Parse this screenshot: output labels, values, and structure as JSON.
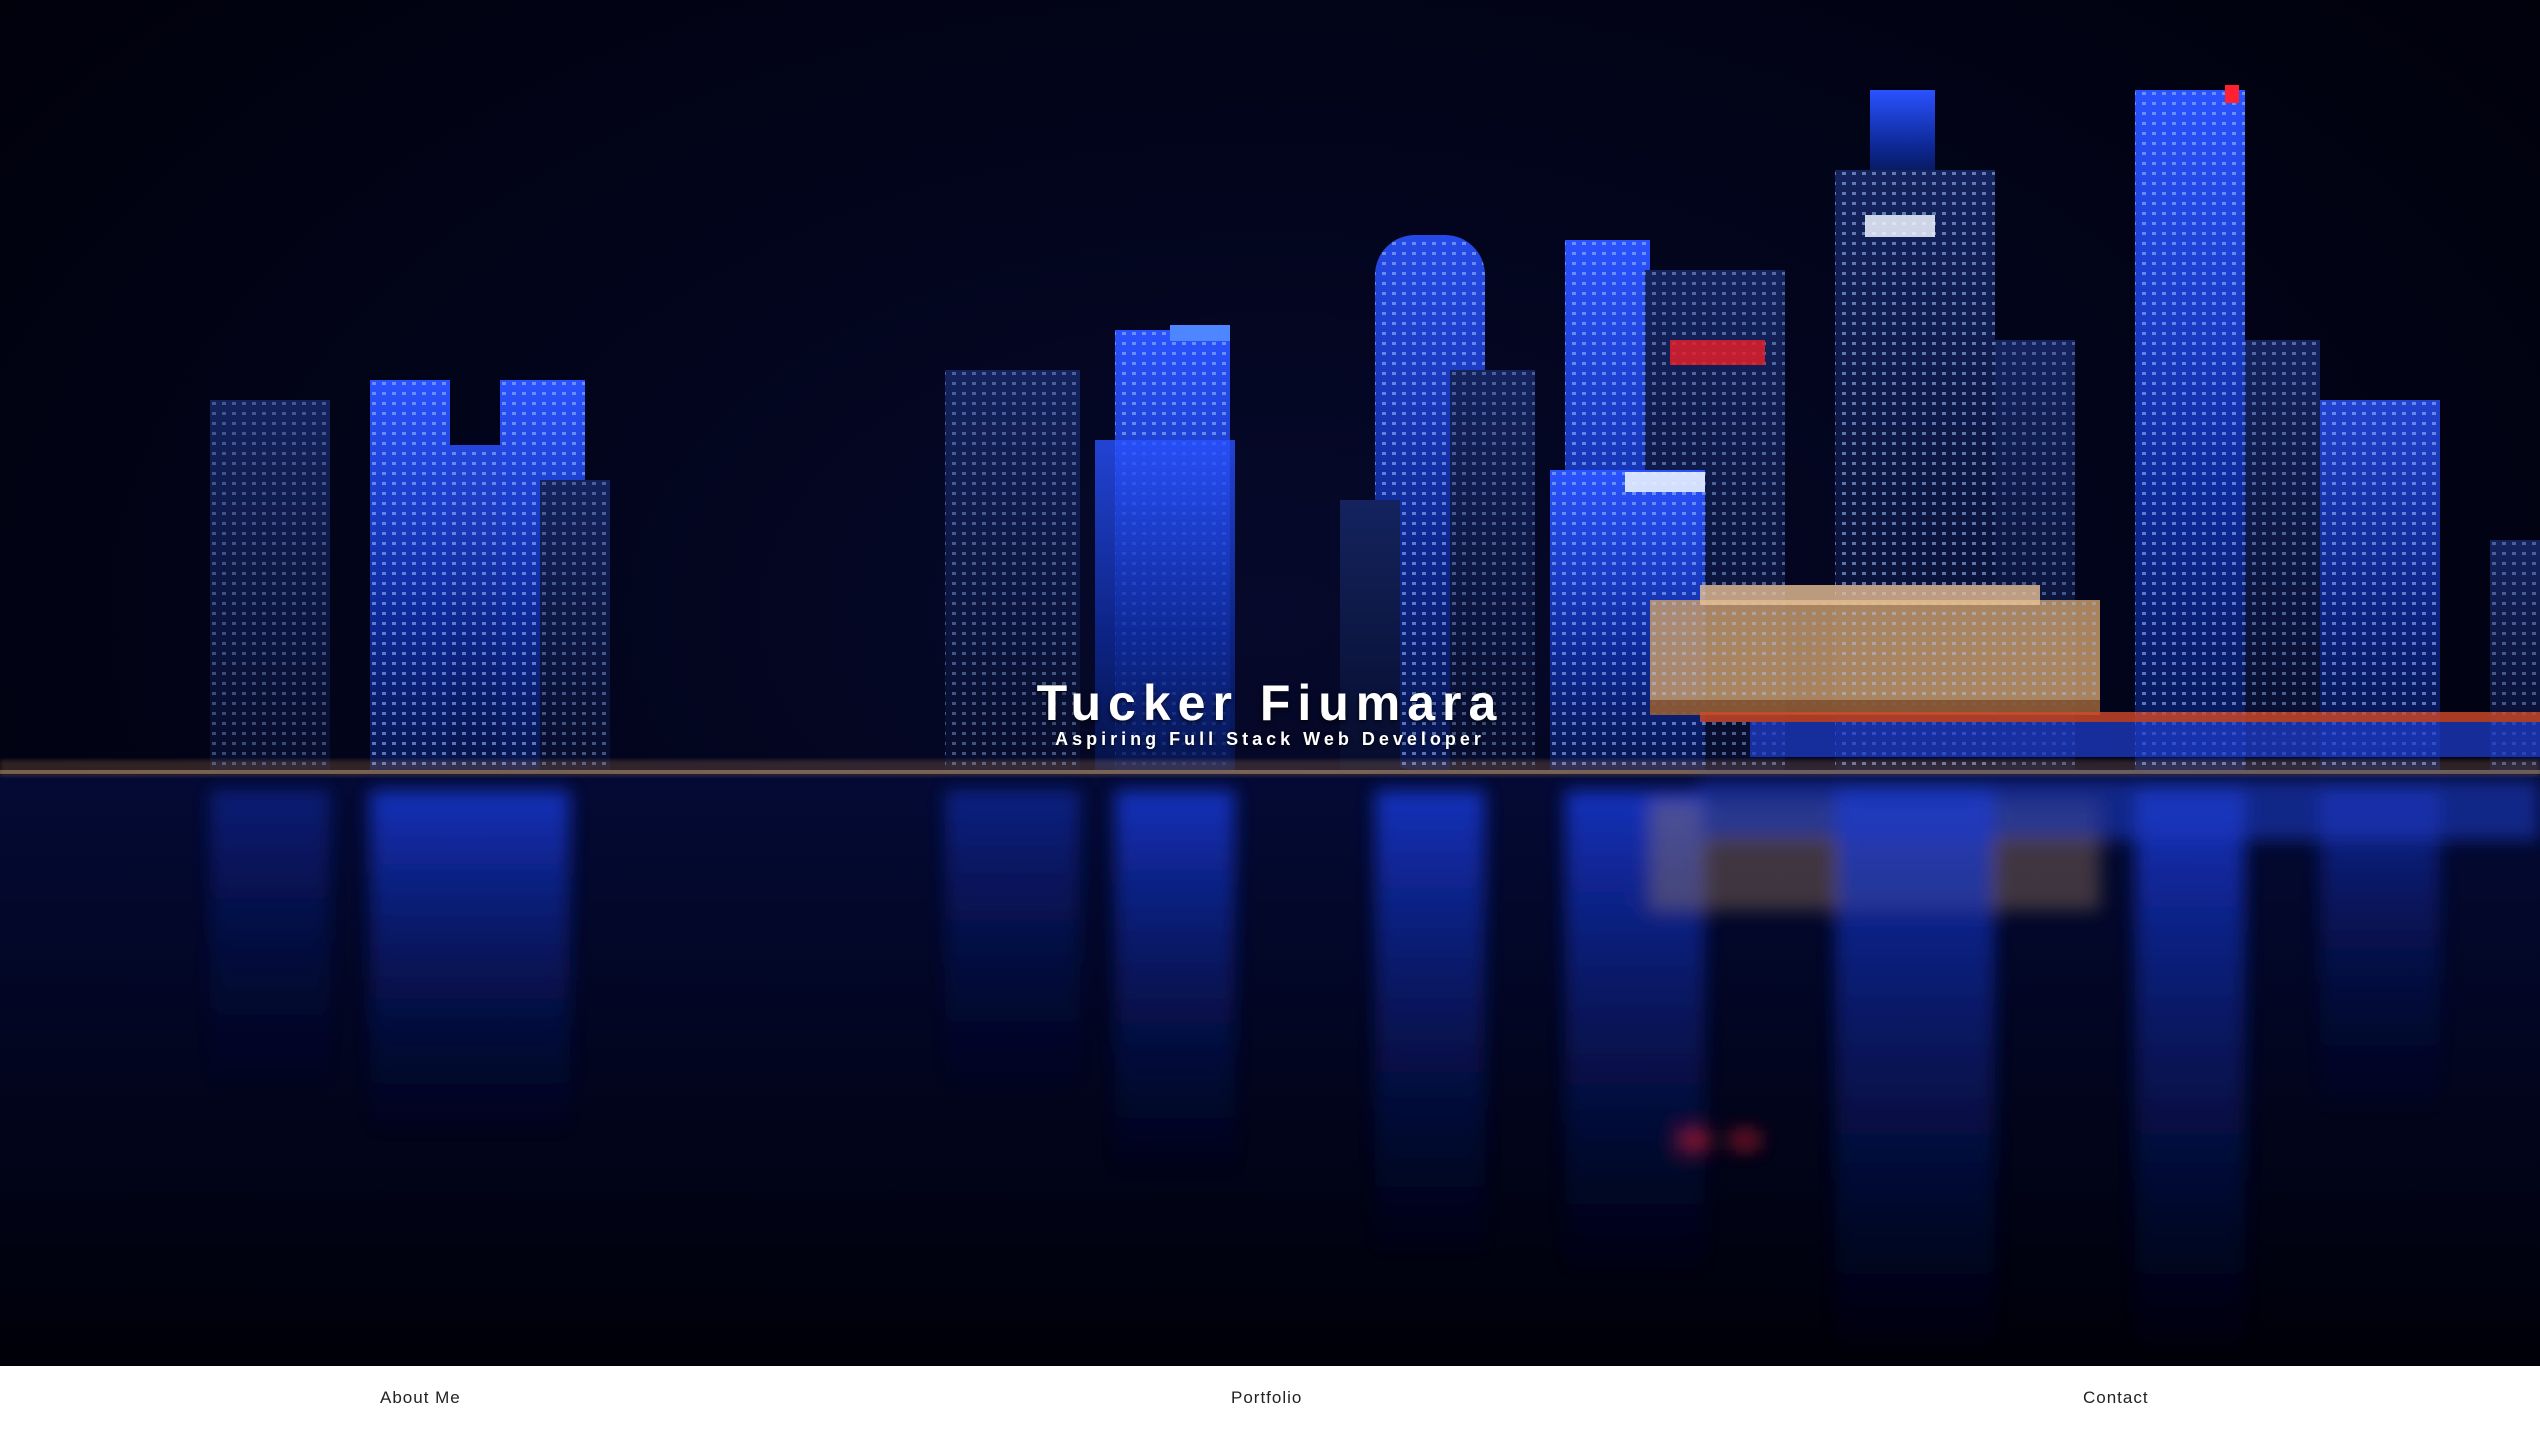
{
  "hero": {
    "title": "Tucker Fiumara",
    "subtitle": "Aspiring Full Stack Web Developer",
    "background_image": "night-city-skyline-reflection"
  },
  "nav": {
    "items": [
      {
        "label": "About Me"
      },
      {
        "label": "Portfolio"
      },
      {
        "label": "Contact"
      }
    ]
  },
  "colors": {
    "night_sky": "#02041a",
    "building_blue": "#1a3fd6",
    "nav_background": "#ffffff",
    "nav_text": "#222222",
    "hero_text": "#ffffff"
  }
}
